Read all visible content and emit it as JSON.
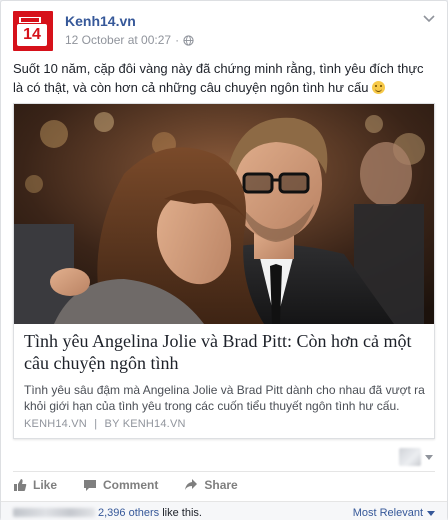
{
  "post": {
    "page_name": "Kenh14.vn",
    "avatar_text": "14",
    "timestamp": "12 October at 00:27",
    "dot": "·",
    "message": "Suốt 10 năm, cặp đôi vàng này đã chứng minh rằng, tình yêu đích thực là có thật, và còn hơn cả những câu chuyện ngôn tình hư cấu",
    "message_emoji": "smile-emoji"
  },
  "link_card": {
    "title": "Tình yêu Angelina Jolie và Brad Pitt: Còn hơn cả một câu chuyện ngôn tình",
    "description": "Tình yêu sâu đậm mà Angelina Jolie và Brad Pitt dành cho nhau đã vượt ra khỏi giới hạn của tình yêu trong các cuốn tiểu thuyết ngôn tình hư cấu.",
    "source_domain": "KENH14.VN",
    "source_sep": "|",
    "source_by": "BY",
    "source_author": "KENH14.VN"
  },
  "actions": {
    "like": "Like",
    "comment": "Comment",
    "share": "Share"
  },
  "likes": {
    "count_text": "2,396 others",
    "suffix": " like this.",
    "sort_label": "Most Relevant"
  },
  "colors": {
    "brand_red": "#d6111a",
    "link_blue": "#365899",
    "meta_grey": "#90949c"
  },
  "icons": [
    "globe-icon",
    "chevron-down-icon",
    "like-icon",
    "comment-icon",
    "share-icon"
  ]
}
